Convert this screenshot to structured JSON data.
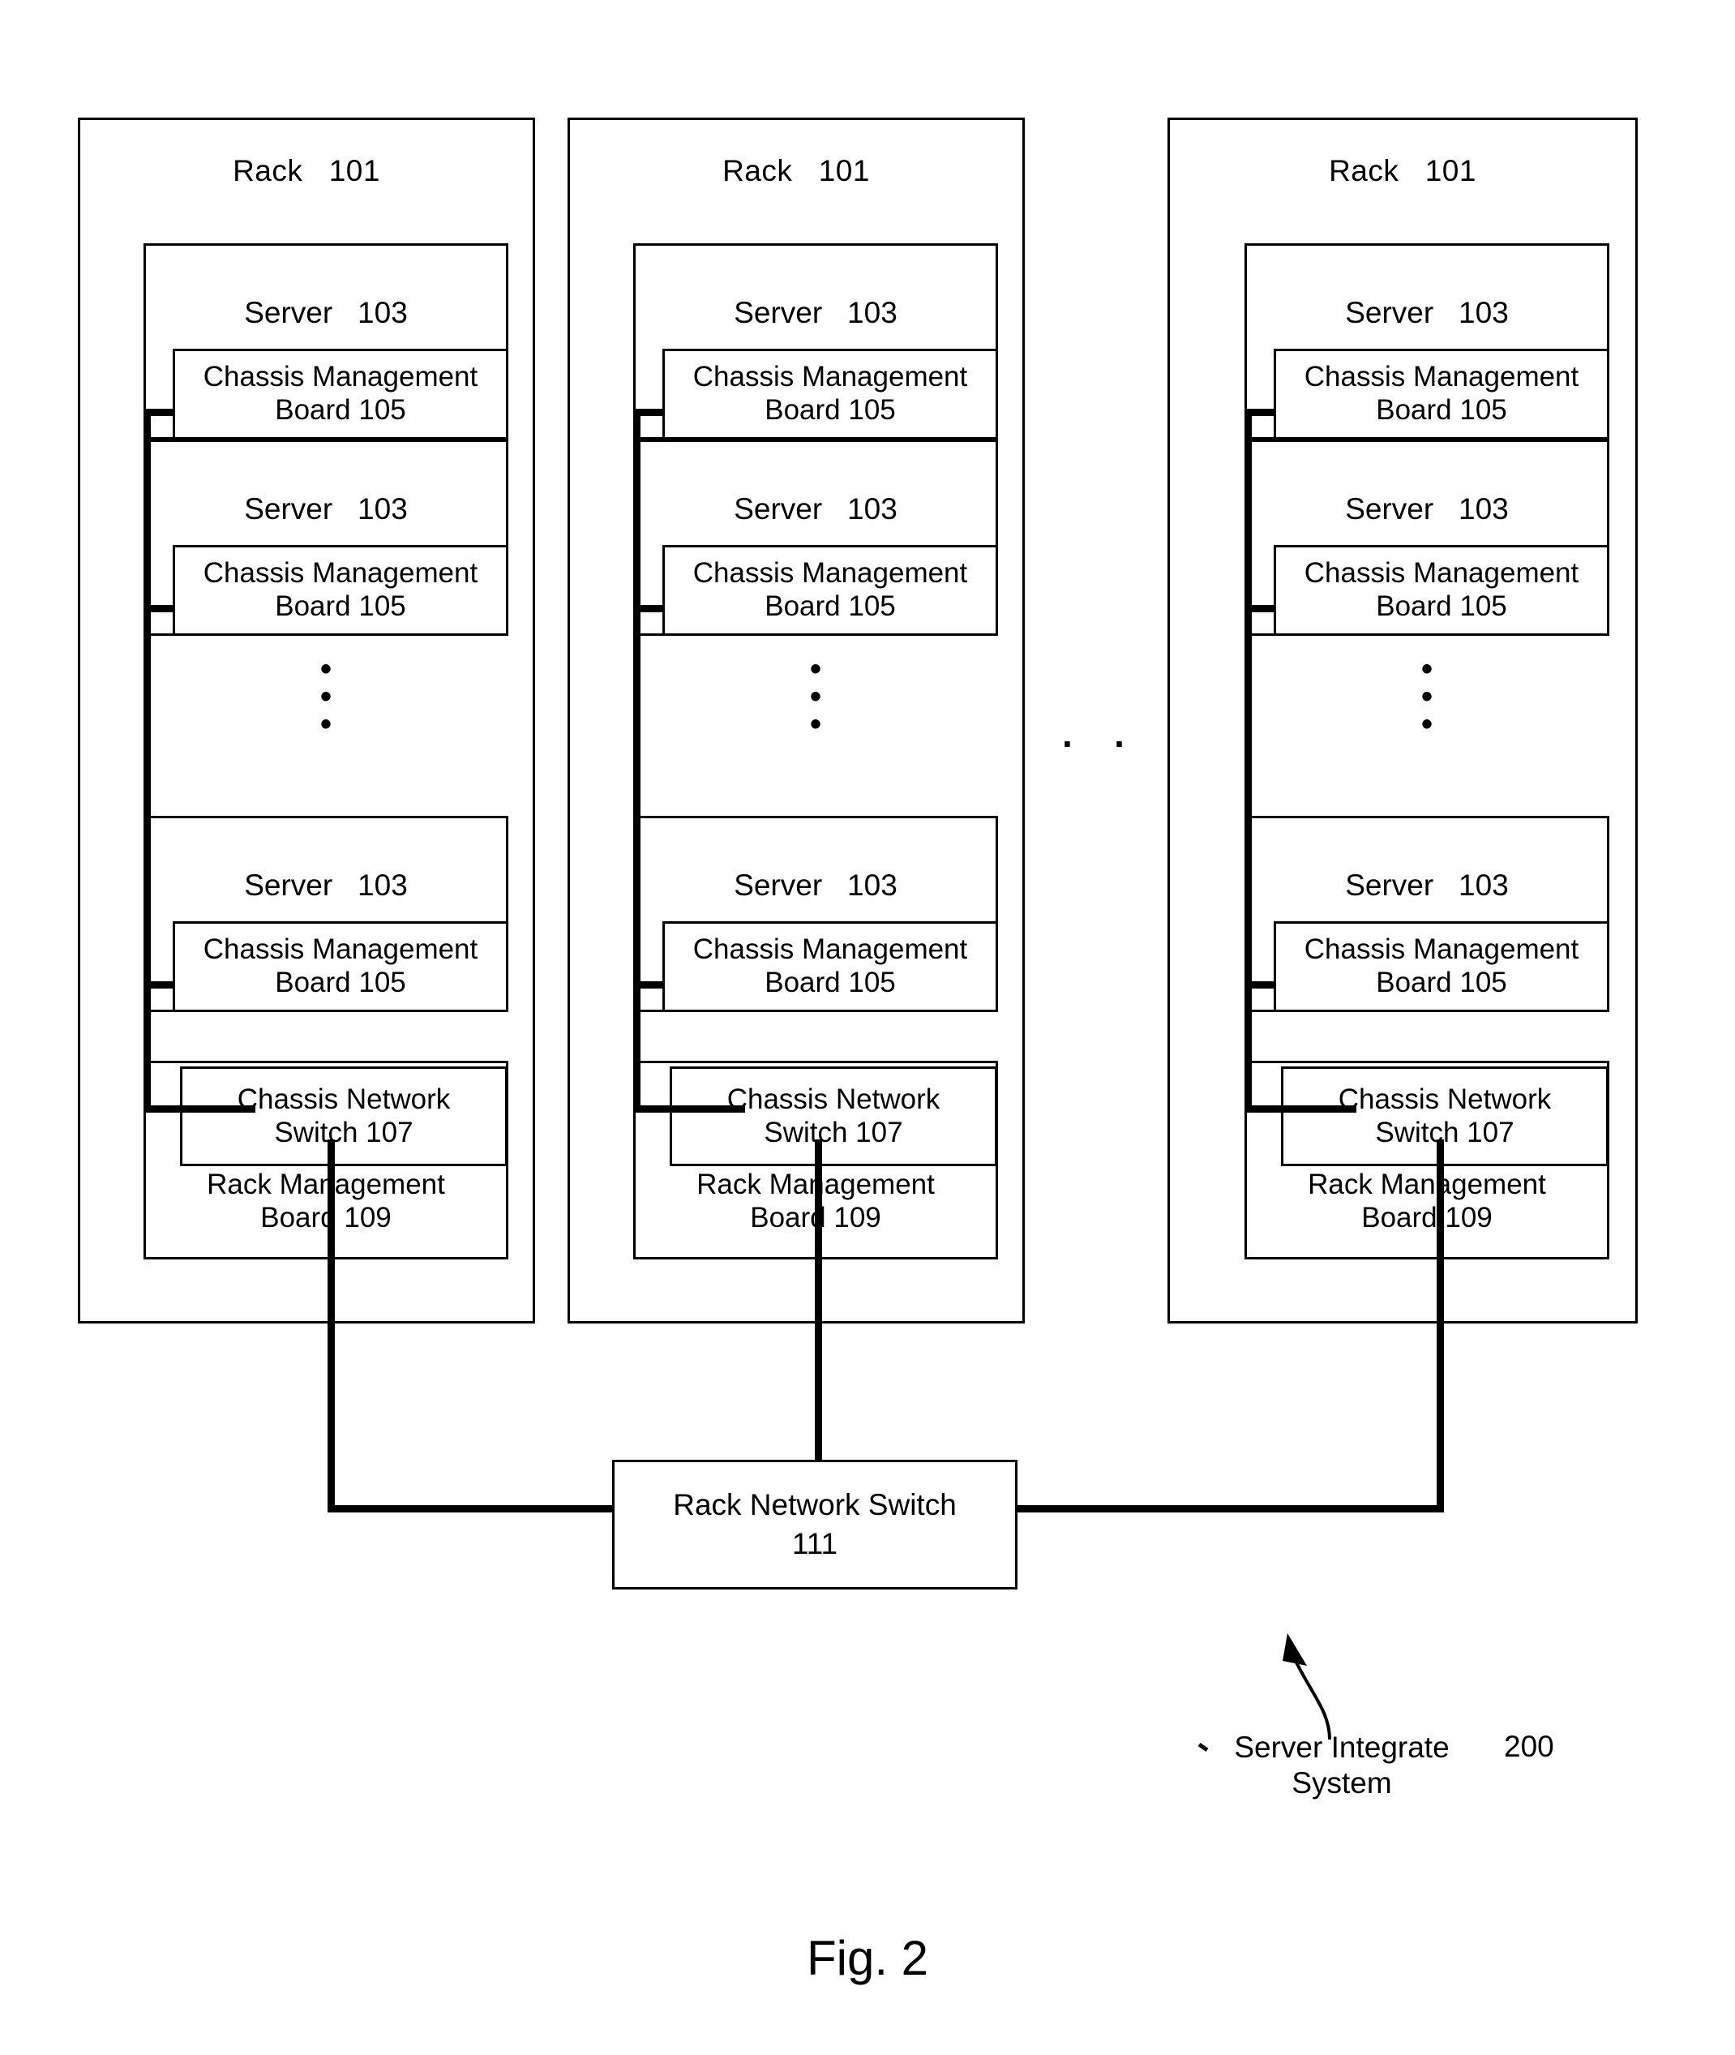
{
  "figure": {
    "caption": "Fig. 2",
    "horizontal_ellipsis": "· · ·"
  },
  "racks": [
    {
      "title": "Rack   101",
      "servers": [
        {
          "title": "Server   103",
          "board": "Chassis Management\nBoard  105"
        },
        {
          "title": "Server   103",
          "board": "Chassis Management\nBoard  105"
        },
        {
          "title": "Server   103",
          "board": "Chassis Management\nBoard  105"
        }
      ],
      "vertical_ellipsis": "•\n•\n•",
      "chassis_network_switch": "Chassis Network\nSwitch    107",
      "rack_management_board": "Rack Management\nBoard    109"
    },
    {
      "title": "Rack   101",
      "servers": [
        {
          "title": "Server   103",
          "board": "Chassis Management\nBoard  105"
        },
        {
          "title": "Server   103",
          "board": "Chassis Management\nBoard  105"
        },
        {
          "title": "Server   103",
          "board": "Chassis Management\nBoard  105"
        }
      ],
      "vertical_ellipsis": "•\n•\n•",
      "chassis_network_switch": "Chassis Network\nSwitch    107",
      "rack_management_board": "Rack Management\nBoard    109"
    },
    {
      "title": "Rack   101",
      "servers": [
        {
          "title": "Server   103",
          "board": "Chassis Management\nBoard  105"
        },
        {
          "title": "Server   103",
          "board": "Chassis Management\nBoard  105"
        },
        {
          "title": "Server   103",
          "board": "Chassis Management\nBoard  105"
        }
      ],
      "vertical_ellipsis": "•\n•\n•",
      "chassis_network_switch": "Chassis Network\nSwitch    107",
      "rack_management_board": "Rack Management\nBoard    109"
    }
  ],
  "rack_network_switch": {
    "line1": "Rack Network Switch",
    "line2": "111"
  },
  "callout": {
    "label": "Server Integrate\nSystem",
    "number": "200"
  },
  "colors": {
    "stroke": "#000000",
    "background": "#ffffff"
  }
}
